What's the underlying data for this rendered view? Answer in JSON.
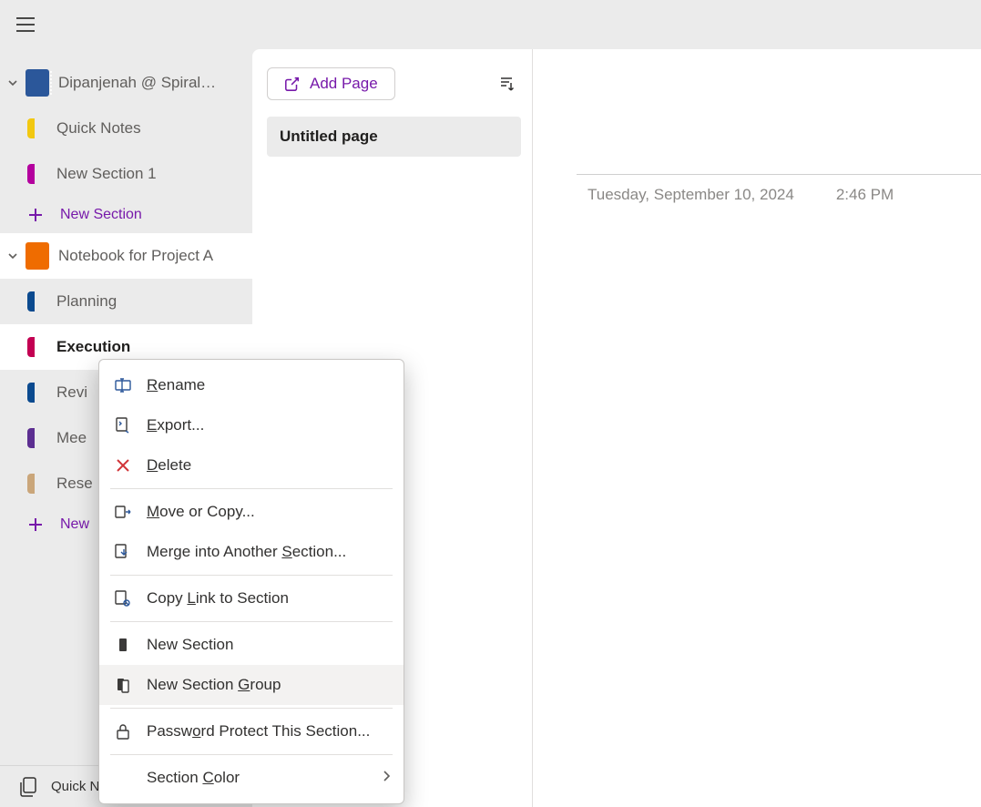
{
  "colors": {
    "accent": "#7719aa",
    "notebook1": "#2b579a",
    "notebook2": "#ef6c00"
  },
  "sidebar": {
    "notebooks": [
      {
        "title": "Dipanjenah @ Spiral…",
        "icon_color": "#2b579a",
        "selected": false,
        "sections": [
          {
            "label": "Quick Notes",
            "color": "#f2c811",
            "selected": false
          },
          {
            "label": "New Section 1",
            "color": "#b4009e",
            "selected": false
          }
        ],
        "new_section_label": "New Section"
      },
      {
        "title": "Notebook for Project A",
        "icon_color": "#ef6c00",
        "selected": true,
        "sections": [
          {
            "label": "Planning",
            "color": "#0b4a8f",
            "selected": false
          },
          {
            "label": "Execution",
            "color": "#c30052",
            "selected": true
          },
          {
            "label": "Revi",
            "color": "#0b4a8f",
            "selected": false
          },
          {
            "label": "Mee",
            "color": "#5c2e91",
            "selected": false
          },
          {
            "label": "Rese",
            "color": "#caa67a",
            "selected": false
          }
        ],
        "new_section_label": "New"
      }
    ],
    "footer_label": "Quick Notes"
  },
  "pages": {
    "add_label": "Add Page",
    "items": [
      {
        "title": "Untitled page",
        "selected": true
      }
    ]
  },
  "note": {
    "date": "Tuesday, September 10, 2024",
    "time": "2:46 PM"
  },
  "context_menu": {
    "items": [
      {
        "id": "rename",
        "label": "Rename",
        "u": 0,
        "icon": "rename"
      },
      {
        "id": "export",
        "label": "Export...",
        "u": 0,
        "icon": "export"
      },
      {
        "id": "delete",
        "label": "Delete",
        "u": 0,
        "icon": "delete"
      },
      {
        "id": "move",
        "label": "Move or Copy...",
        "u": 0,
        "icon": "move",
        "sep_before": true
      },
      {
        "id": "merge",
        "label": "Merge into Another Section...",
        "u": 19,
        "icon": "merge"
      },
      {
        "id": "copylink",
        "label": "Copy Link to Section",
        "u": 5,
        "icon": "copylink",
        "sep_before": true
      },
      {
        "id": "newsection",
        "label": "New Section",
        "u": -1,
        "icon": "section",
        "sep_before": true
      },
      {
        "id": "newgroup",
        "label": "New Section Group",
        "u": 12,
        "icon": "group",
        "hover": true
      },
      {
        "id": "password",
        "label": "Password Protect This Section...",
        "u": 5,
        "icon": "lock",
        "sep_before": true
      },
      {
        "id": "color",
        "label": "Section Color",
        "u": 8,
        "submenu": true,
        "sep_before": true
      }
    ]
  }
}
